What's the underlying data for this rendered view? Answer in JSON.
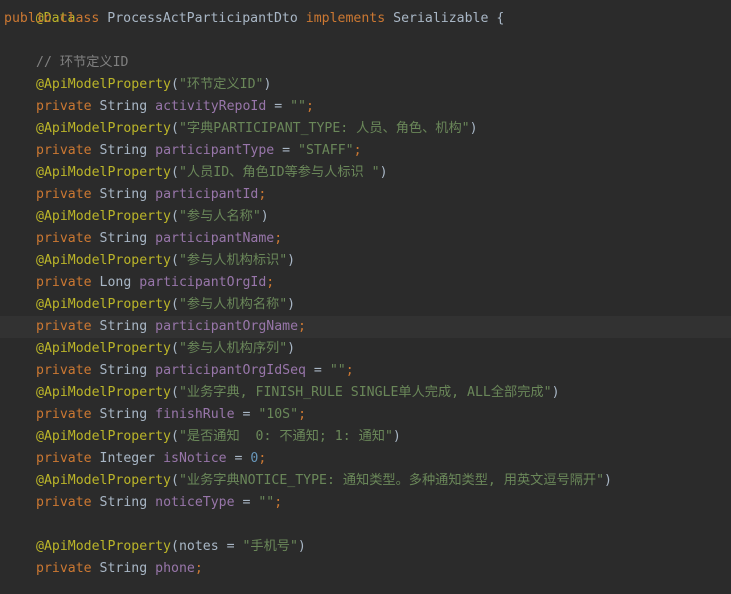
{
  "colors": {
    "background": "#2b2b2b",
    "current_line": "#323232",
    "keyword": "#cc7832",
    "annotation": "#bbb529",
    "string": "#6a8759",
    "field": "#9876aa",
    "number": "#6897bb",
    "comment": "#808080",
    "text": "#a9b7c6"
  },
  "code": {
    "line0": {
      "ann": "@Data"
    },
    "line1": {
      "kw1": "public",
      "kw2": "class",
      "name": "ProcessActParticipantDto",
      "kw3": "implements",
      "iface": "Serializable",
      "brace": "{"
    },
    "line3": {
      "comment": "// 环节定义ID"
    },
    "line4": {
      "ann": "@ApiModelProperty",
      "open": "(",
      "str": "\"环节定义ID\"",
      "close": ")"
    },
    "line5": {
      "kw": "private",
      "type": "String",
      "field": "activityRepoId",
      "eq": " = ",
      "val": "\"\"",
      "semi": ";"
    },
    "line6": {
      "ann": "@ApiModelProperty",
      "open": "(",
      "str": "\"字典PARTICIPANT_TYPE: 人员、角色、机构\"",
      "close": ")"
    },
    "line7": {
      "kw": "private",
      "type": "String",
      "field": "participantType",
      "eq": " = ",
      "val": "\"STAFF\"",
      "semi": ";"
    },
    "line8": {
      "ann": "@ApiModelProperty",
      "open": "(",
      "str": "\"人员ID、角色ID等参与人标识 \"",
      "close": ")"
    },
    "line9": {
      "kw": "private",
      "type": "String",
      "field": "participantId",
      "semi": ";"
    },
    "line10": {
      "ann": "@ApiModelProperty",
      "open": "(",
      "str": "\"参与人名称\"",
      "close": ")"
    },
    "line11": {
      "kw": "private",
      "type": "String",
      "field": "participantName",
      "semi": ";"
    },
    "line12": {
      "ann": "@ApiModelProperty",
      "open": "(",
      "str": "\"参与人机构标识\"",
      "close": ")"
    },
    "line13": {
      "kw": "private",
      "type": "Long",
      "field": "participantOrgId",
      "semi": ";"
    },
    "line14": {
      "ann": "@ApiModelProperty",
      "open": "(",
      "str": "\"参与人机构名称\"",
      "close": ")"
    },
    "line15": {
      "kw": "private",
      "type": "String",
      "field": "participantOrgName",
      "semi": ";"
    },
    "line16": {
      "ann": "@ApiModelProperty",
      "open": "(",
      "str": "\"参与人机构序列\"",
      "close": ")"
    },
    "line17": {
      "kw": "private",
      "type": "String",
      "field": "participantOrgIdSeq",
      "eq": " = ",
      "val": "\"\"",
      "semi": ";"
    },
    "line18": {
      "ann": "@ApiModelProperty",
      "open": "(",
      "str": "\"业务字典, FINISH_RULE SINGLE单人完成, ALL全部完成\"",
      "close": ")"
    },
    "line19": {
      "kw": "private",
      "type": "String",
      "field": "finishRule",
      "eq": " = ",
      "val": "\"10S\"",
      "semi": ";"
    },
    "line20": {
      "ann": "@ApiModelProperty",
      "open": "(",
      "str": "\"是否通知  0: 不通知; 1: 通知\"",
      "close": ")"
    },
    "line21": {
      "kw": "private",
      "type": "Integer",
      "field": "isNotice",
      "eq": " = ",
      "val": "0",
      "semi": ";"
    },
    "line22": {
      "ann": "@ApiModelProperty",
      "open": "(",
      "str": "\"业务字典NOTICE_TYPE: 通知类型。多种通知类型, 用英文逗号隔开\"",
      "close": ")"
    },
    "line23": {
      "kw": "private",
      "type": "String",
      "field": "noticeType",
      "eq": " = ",
      "val": "\"\"",
      "semi": ";"
    },
    "line25": {
      "ann": "@ApiModelProperty",
      "open": "(",
      "param": "notes",
      "eq": " = ",
      "str": "\"手机号\"",
      "close": ")"
    },
    "line26": {
      "kw": "private",
      "type": "String",
      "field": "phone",
      "semi": ";"
    }
  }
}
